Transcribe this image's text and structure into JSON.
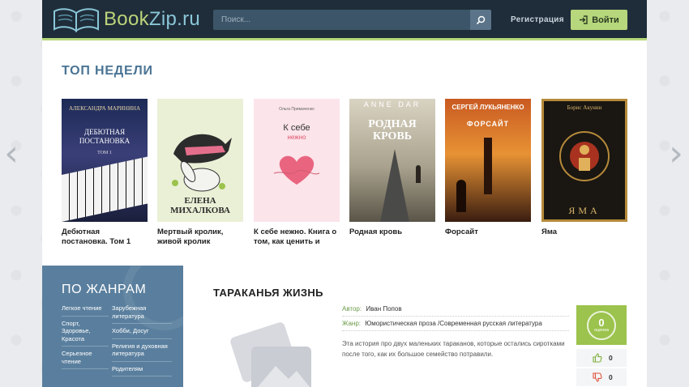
{
  "brand": {
    "logo_part1": "Book",
    "logo_part2": "Zip.ru",
    "colors": {
      "accent": "#b6d77b",
      "header": "#1f2d3a",
      "brand_blue": "#4a7494",
      "sidebar": "#5a7f9e"
    }
  },
  "header": {
    "search_placeholder": "Поиск...",
    "register_label": "Регистрация",
    "login_label": "Войти"
  },
  "top_week": {
    "title": "ТОП НЕДЕЛИ",
    "books": [
      {
        "title": "Дебютная постановка. Том 1",
        "cover_author": "АЛЕКСАНДРА МАРИНИНА",
        "cover_title": "ДЕБЮТНАЯ ПОСТАНОВКА",
        "cover_sub": "ТОМ 1"
      },
      {
        "title": "Мертвый кролик, живой кролик",
        "cover_author": "ЕЛЕНА МИХАЛКОВА"
      },
      {
        "title": "К себе нежно. Книга о том, как ценить и",
        "cover_author": "Ольга Примаченко",
        "cover_title": "К себе",
        "cover_sub": "нежно"
      },
      {
        "title": "Родная кровь",
        "cover_author": "ANNE DAR",
        "cover_title": "РОДНАЯ КРОВЬ"
      },
      {
        "title": "Форсайт",
        "cover_author": "СЕРГЕЙ ЛУКЬЯНЕНКО",
        "cover_title": "ФОРСАЙТ"
      },
      {
        "title": "Яма",
        "cover_author": "Борис Акунин",
        "cover_title": "ЯМА"
      }
    ]
  },
  "genres": {
    "title": "ПО ЖАНРАМ",
    "col1": [
      "Легкое чтение",
      "Спорт, Здоровье, Красота",
      "Серьезное чтение"
    ],
    "col2": [
      "Зарубежная литература",
      "Хобби, Досуг",
      "Религия и духовная литература",
      "Родителям"
    ]
  },
  "detail": {
    "title": "ТАРАКАНЬЯ ЖИЗНЬ",
    "author_label": "Автор:",
    "author_value": "Иван Попов",
    "genre_label": "Жанр:",
    "genre_value": "Юмористическая проза /Современная русская литература",
    "description": "Эта история про двух маленьких тараканов, которые остались сиротками после того, как их большое семейство потравили.",
    "rating_value": "0",
    "rating_label": "оценка",
    "likes": "0",
    "dislikes": "0"
  }
}
